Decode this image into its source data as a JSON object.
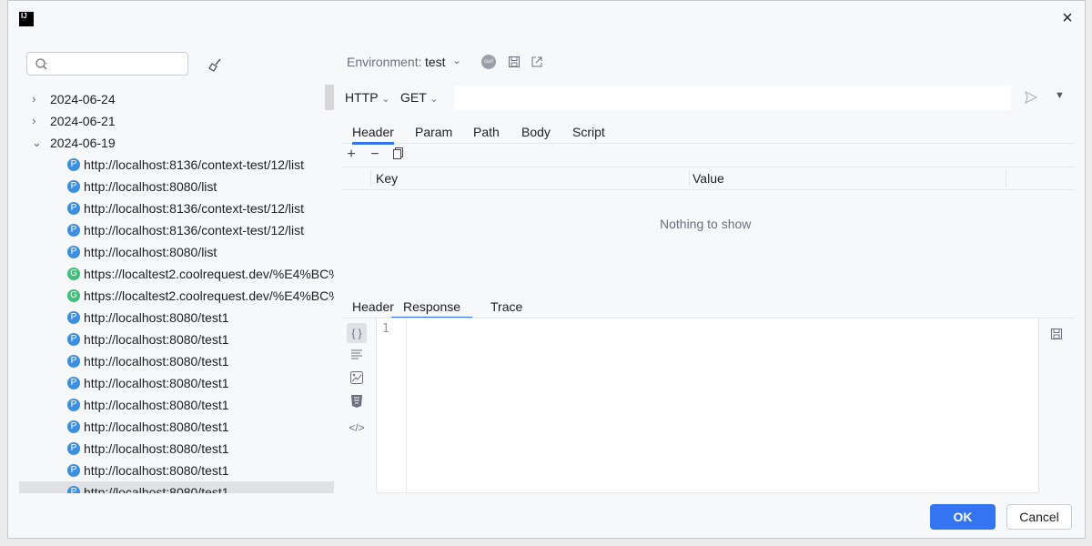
{
  "window": {
    "app_icon_text": "IJ",
    "close_symbol": "×"
  },
  "sidebar": {
    "search": {
      "placeholder": "",
      "value": ""
    },
    "tree": [
      {
        "type": "date",
        "label": "2024-06-24",
        "expanded": false
      },
      {
        "type": "date",
        "label": "2024-06-21",
        "expanded": false
      },
      {
        "type": "date",
        "label": "2024-06-19",
        "expanded": true
      },
      {
        "type": "url",
        "badge": "P",
        "label": "http://localhost:8136/context-test/12/list"
      },
      {
        "type": "url",
        "badge": "P",
        "label": "http://localhost:8080/list"
      },
      {
        "type": "url",
        "badge": "P",
        "label": "http://localhost:8136/context-test/12/list"
      },
      {
        "type": "url",
        "badge": "P",
        "label": "http://localhost:8136/context-test/12/list"
      },
      {
        "type": "url",
        "badge": "P",
        "label": "http://localhost:8080/list"
      },
      {
        "type": "url",
        "badge": "G",
        "label": "https://localtest2.coolrequest.dev/%E4%BC%"
      },
      {
        "type": "url",
        "badge": "G",
        "label": "https://localtest2.coolrequest.dev/%E4%BC%"
      },
      {
        "type": "url",
        "badge": "P",
        "label": "http://localhost:8080/test1"
      },
      {
        "type": "url",
        "badge": "P",
        "label": "http://localhost:8080/test1"
      },
      {
        "type": "url",
        "badge": "P",
        "label": "http://localhost:8080/test1"
      },
      {
        "type": "url",
        "badge": "P",
        "label": "http://localhost:8080/test1"
      },
      {
        "type": "url",
        "badge": "P",
        "label": "http://localhost:8080/test1"
      },
      {
        "type": "url",
        "badge": "P",
        "label": "http://localhost:8080/test1"
      },
      {
        "type": "url",
        "badge": "P",
        "label": "http://localhost:8080/test1"
      },
      {
        "type": "url",
        "badge": "P",
        "label": "http://localhost:8080/test1"
      },
      {
        "type": "url",
        "badge": "P",
        "label": "http://localhost:8080/test1",
        "selected": true
      }
    ]
  },
  "request": {
    "environment_label": "Environment:",
    "environment_value": "test",
    "curl_icon_text": "curl",
    "protocol": "HTTP",
    "method": "GET",
    "url_value": "",
    "request_tabs": [
      "Header",
      "Param",
      "Path",
      "Body",
      "Script"
    ],
    "active_request_tab": "Header",
    "table_columns": [
      "Key",
      "Value"
    ],
    "empty_text": "Nothing to show"
  },
  "response": {
    "tabs": [
      "Header",
      "Response",
      "Trace"
    ],
    "active_tab": "Response",
    "line_number": "1"
  },
  "footer": {
    "ok_label": "OK",
    "cancel_label": "Cancel"
  },
  "colors": {
    "accent": "#3574f0",
    "badge_p": "#3c8fe0",
    "badge_g": "#3fbf7a"
  }
}
